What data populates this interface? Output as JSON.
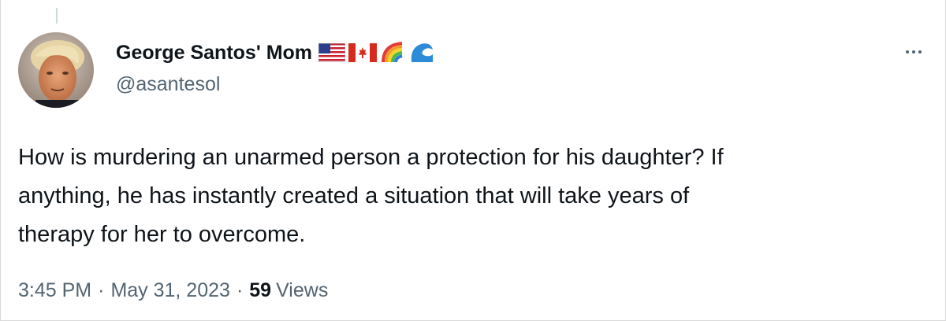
{
  "tweet": {
    "display_name": "George Santos' Mom",
    "handle": "@asantesol",
    "emojis": [
      "us-flag-icon",
      "canada-flag-icon",
      "rainbow-icon",
      "wave-icon"
    ],
    "text_lines": [
      "How is murdering an unarmed person a protection for his daughter? If",
      "anything, he has instantly created a situation that will take years of",
      "therapy for her to overcome."
    ],
    "time": "3:45 PM",
    "date": "May 31, 2023",
    "separator": "·",
    "views_count": "59",
    "views_label": "Views"
  },
  "colors": {
    "text_primary": "#0f1419",
    "text_secondary": "#536471"
  }
}
